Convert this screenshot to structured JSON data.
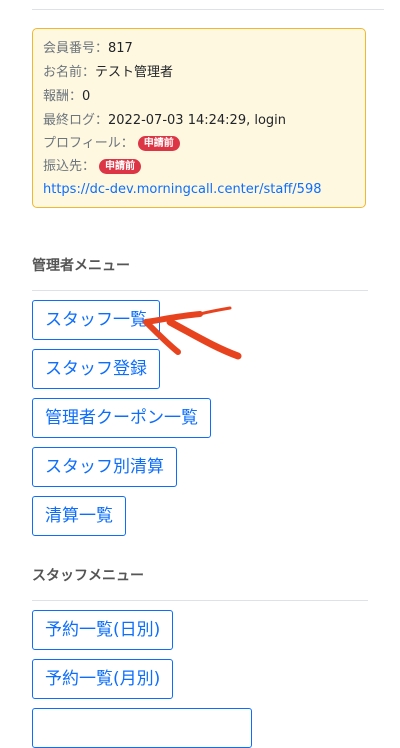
{
  "info": {
    "member_no_label": "会員番号：",
    "member_no": "817",
    "name_label": "お名前：",
    "name": "テスト管理者",
    "reward_label": "報酬：",
    "reward": "0",
    "last_log_label": "最終ログ：",
    "last_log": "2022-07-03 14:24:29, login",
    "profile_label": "プロフィール：",
    "profile_badge": "申請前",
    "transfer_label": "振込先：",
    "transfer_badge": "申請前",
    "staff_url": "https://dc-dev.morningcall.center/staff/598"
  },
  "admin_menu": {
    "title": "管理者メニュー",
    "items": [
      "スタッフ一覧",
      "スタッフ登録",
      "管理者クーポン一覧",
      "スタッフ別清算",
      "清算一覧"
    ]
  },
  "staff_menu": {
    "title": "スタッフメニュー",
    "items": [
      "予約一覧(日別)",
      "予約一覧(月別)"
    ]
  },
  "colors": {
    "accent": "#0d6efd",
    "badge": "#dc3545",
    "info_bg": "#fff8e1",
    "info_border": "#f0b832",
    "annotation_arrow": "#e8431f"
  },
  "icons": {
    "annotation": "red-arrow-icon"
  }
}
